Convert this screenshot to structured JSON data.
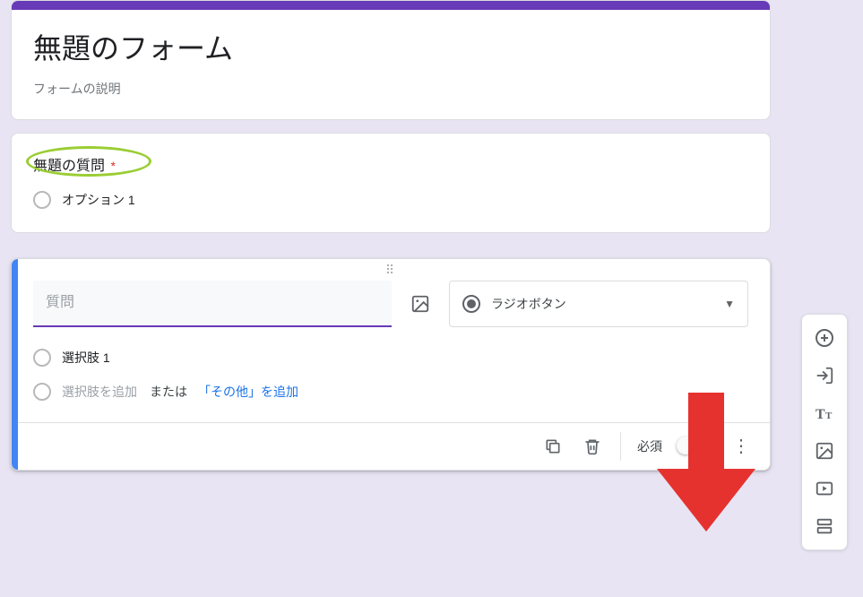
{
  "form": {
    "title": "無題のフォーム",
    "description": "フォームの説明"
  },
  "question1": {
    "title": "無題の質問",
    "required_mark": "*",
    "option1": "オプション 1"
  },
  "editing": {
    "question_placeholder": "質問",
    "type_label": "ラジオボタン",
    "choice1": "選択肢 1",
    "add_choice": "選択肢を追加",
    "or_text": "または",
    "add_other": "「その他」を追加",
    "required_label": "必須"
  },
  "icons": {
    "image": "image-icon",
    "dropdown": "arrow-down-icon",
    "copy": "copy-icon",
    "delete": "trash-icon",
    "more": "more-vert-icon",
    "add_circle": "plus-circle-icon",
    "import": "import-icon",
    "text_title": "title-icon",
    "add_image": "image-icon",
    "add_video": "video-icon",
    "add_section": "section-icon"
  }
}
